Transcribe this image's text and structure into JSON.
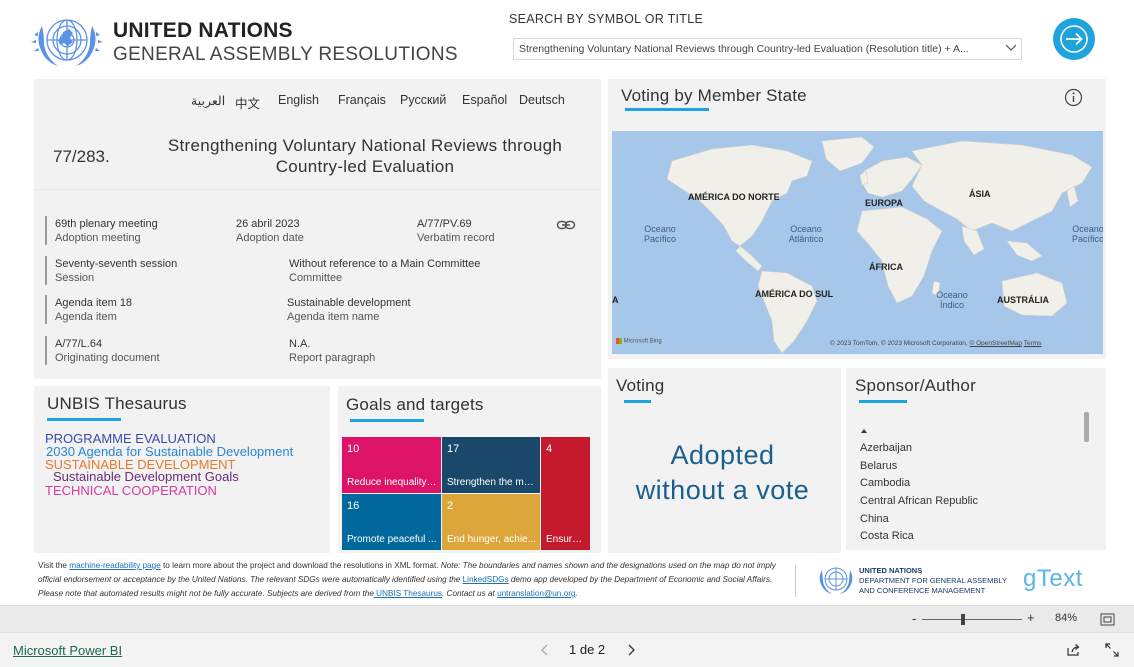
{
  "header": {
    "title_line1": "UNITED NATIONS",
    "title_line2": "GENERAL ASSEMBLY RESOLUTIONS",
    "search_label": "SEARCH BY SYMBOL OR TITLE",
    "search_value": "Strengthening Voluntary National Reviews through Country-led Evaluation (Resolution title) + A...",
    "go_button_icon": "arrow-right-icon"
  },
  "languages": [
    "العربية",
    "中文",
    "English",
    "Français",
    "Русский",
    "Español",
    "Deutsch"
  ],
  "resolution": {
    "number": "77/283.",
    "title": "Strengthening Voluntary National Reviews through Country-led Evaluation",
    "meta": {
      "meeting_value": "69th plenary meeting",
      "meeting_label": "Adoption meeting",
      "date_value": "26 abril 2023",
      "date_label": "Adoption date",
      "verbatim_value": "A/77/PV.69",
      "verbatim_label": "Verbatim record",
      "session_value": "Seventy-seventh session",
      "session_label": "Session",
      "committee_value": "Without reference to a Main Committee",
      "committee_label": "Committee",
      "agenda_value": "Agenda item 18",
      "agenda_label": "Agenda item",
      "agenda_name_value": "Sustainable development",
      "agenda_name_label": "Agenda item name",
      "origin_value": "A/77/L.64",
      "origin_label": "Originating document",
      "report_value": "N.A.",
      "report_label": "Report paragraph"
    }
  },
  "thesaurus": {
    "title": "UNBIS Thesaurus",
    "terms": [
      {
        "text": "PROGRAMME EVALUATION",
        "color": "#3a4aa8"
      },
      {
        "text": "2030 Agenda for Sustainable Development",
        "color": "#2b86d1"
      },
      {
        "text": "SUSTAINABLE DEVELOPMENT",
        "color": "#e47a2e"
      },
      {
        "text": "Sustainable Development Goals",
        "color": "#6a2b78"
      },
      {
        "text": "TECHNICAL COOPERATION",
        "color": "#d63aa3"
      }
    ]
  },
  "goals": {
    "title": "Goals and targets",
    "tiles": [
      {
        "num": "10",
        "text": "Reduce inequality ...",
        "color": "#dd1367"
      },
      {
        "num": "17",
        "text": "Strengthen the me...",
        "color": "#19486a"
      },
      {
        "num": "4",
        "text": "Ensure ...",
        "color": "#c5192d"
      },
      {
        "num": "16",
        "text": "Promote peaceful ...",
        "color": "#00689d"
      },
      {
        "num": "2",
        "text": "End hunger, achie...",
        "color": "#dda63a"
      }
    ]
  },
  "map": {
    "title": "Voting by Member State",
    "info_icon": "info-icon",
    "continents": [
      "AMÉRICA DO NORTE",
      "EUROPA",
      "ÁSIA",
      "ÁFRICA",
      "AMÉRICA DO SUL",
      "AUSTRÁLIA",
      "A"
    ],
    "oceans": [
      "Oceano Pacífico",
      "Oceano Atlântico",
      "Oceano Índico",
      "Oceano Pacífico"
    ],
    "bing_logo": "Microsoft Bing",
    "attribution": "© 2023 TomTom, © 2023 Microsoft Corporation,",
    "osm_link": "© OpenStreetMap",
    "terms_link": "Terms"
  },
  "voting": {
    "title": "Voting",
    "result_line1": "Adopted",
    "result_line2": "without a vote"
  },
  "sponsors": {
    "title": "Sponsor/Author",
    "list": [
      "Azerbaijan",
      "Belarus",
      "Cambodia",
      "Central African Republic",
      "China",
      "Costa Rica"
    ]
  },
  "footer": {
    "t1": "Visit the ",
    "link1": "machine-readability page",
    "t2": " to learn more about the project and download the resolutions in XML format. ",
    "note1": "Note: The boundaries and names shown and the designations used on the map do not imply official endorsement or acceptance by the United Nations. The relevant SDGs were automatically identified using the ",
    "link2": "LinkedSDGs",
    "note2": " demo app developed by the Department of Economic and Social Affairs. Please note that automated results might not be fully accurate. Subjects are derived from the",
    "link3": " UNBIS Thesaurus",
    "note3": ". Contact us at ",
    "link4": "untranslation@un.org",
    "note4": ".",
    "dept_line1": "UNITED NATIONS",
    "dept_line2": "DEPARTMENT FOR GENERAL ASSEMBLY",
    "dept_line3": "AND CONFERENCE MANAGEMENT",
    "gtext": "gText"
  },
  "powerbi": {
    "zoom_minus": "-",
    "zoom_plus": "+",
    "zoom_level": "84%",
    "brand_link": "Microsoft Power BI",
    "page_indicator": "1 de 2"
  }
}
